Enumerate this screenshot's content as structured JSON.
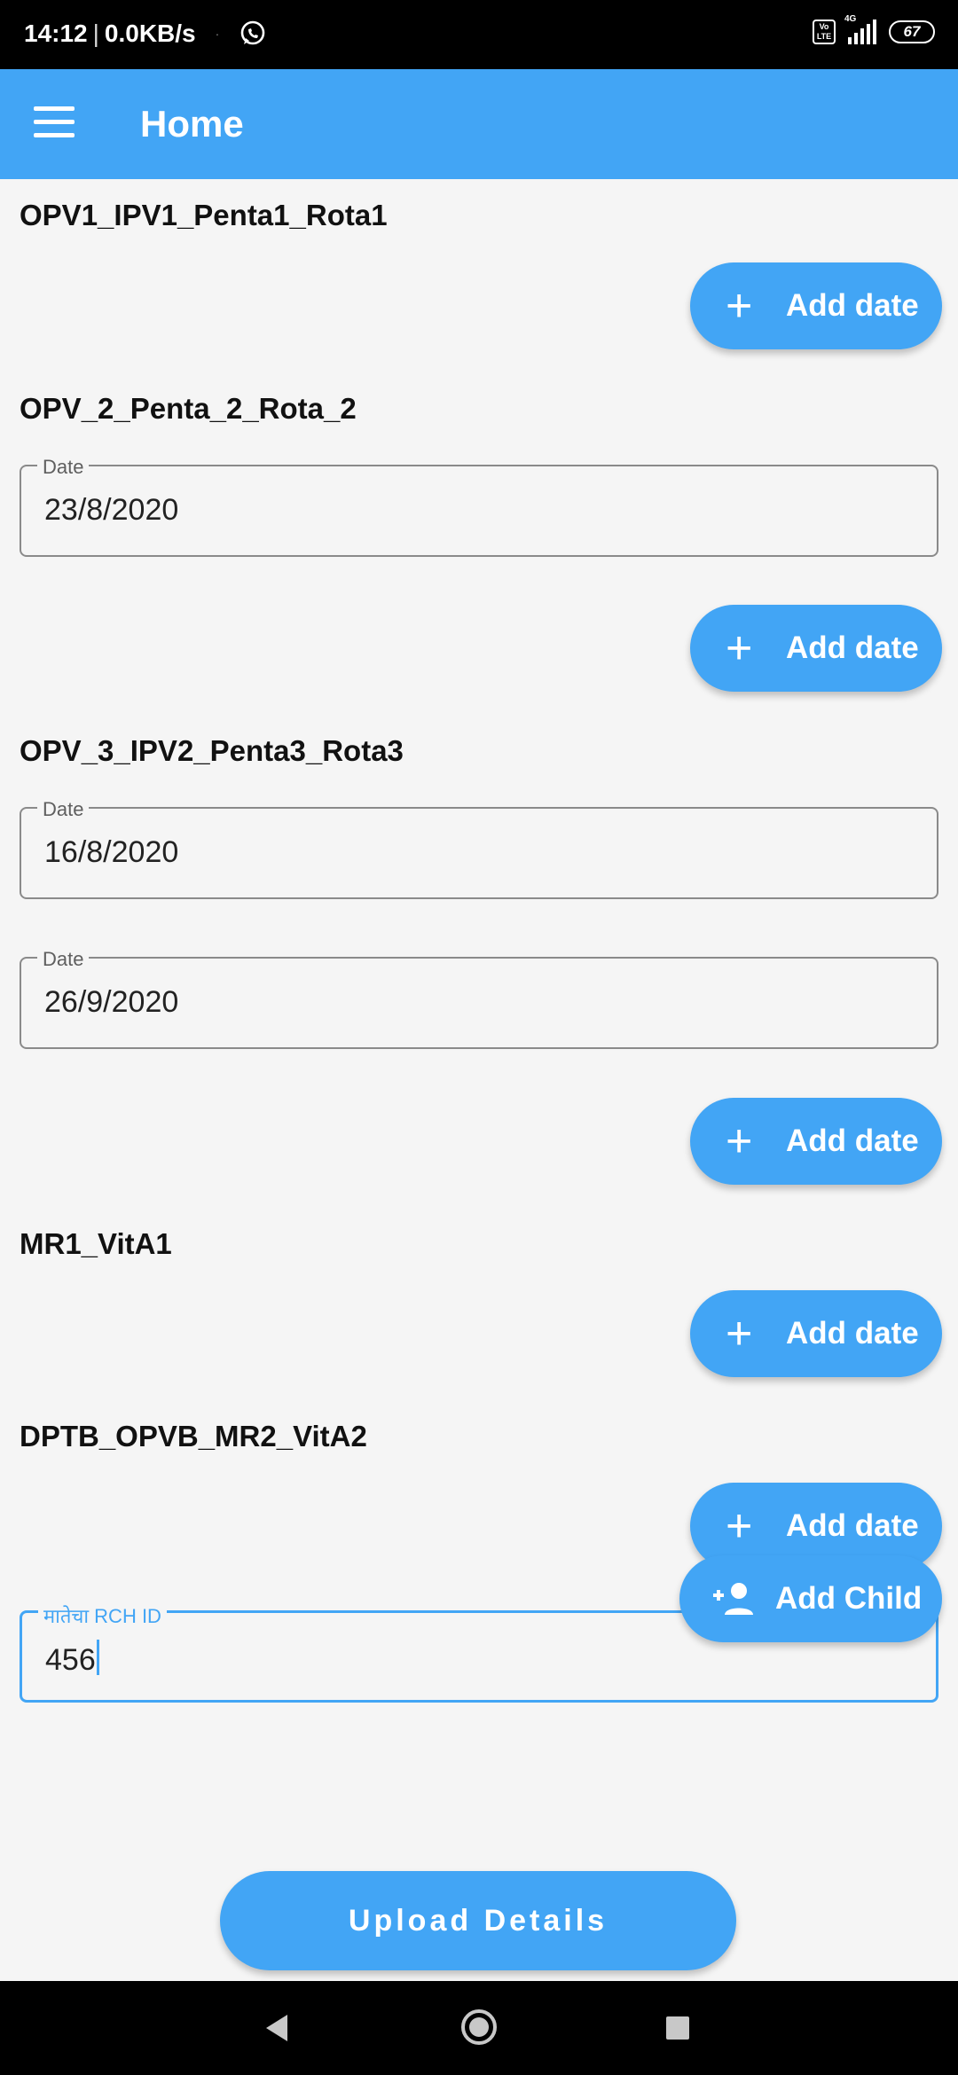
{
  "status_bar": {
    "time": "14:12",
    "speed": "0.0KB/s",
    "whatsapp_icon": "whatsapp-icon",
    "volte": "Vo LTE",
    "network": "4G",
    "battery": "67"
  },
  "app_bar": {
    "menu_icon": "menu-icon",
    "title": "Home"
  },
  "sections": [
    {
      "title": "OPV1_IPV1_Penta1_Rota1",
      "dates": [],
      "add_label": "Add date"
    },
    {
      "title": "OPV_2_Penta_2_Rota_2",
      "dates": [
        {
          "label": "Date",
          "value": "23/8/2020"
        }
      ],
      "add_label": "Add date"
    },
    {
      "title": "OPV_3_IPV2_Penta3_Rota3",
      "dates": [
        {
          "label": "Date",
          "value": "16/8/2020"
        },
        {
          "label": "Date",
          "value": "26/9/2020"
        }
      ],
      "add_label": "Add date"
    },
    {
      "title": "MR1_VitA1",
      "dates": [],
      "add_label": "Add date"
    },
    {
      "title": "DPTB_OPVB_MR2_VitA2",
      "dates": [],
      "add_label": "Add date"
    }
  ],
  "rch_field": {
    "label": "मातेचा RCH ID",
    "value": "456"
  },
  "add_child": {
    "label": "Add Child",
    "icon": "person-add-icon"
  },
  "upload": {
    "label": "Upload Details"
  },
  "colors": {
    "primary": "#42a5f5",
    "background": "#f5f5f5",
    "text": "#111111"
  }
}
